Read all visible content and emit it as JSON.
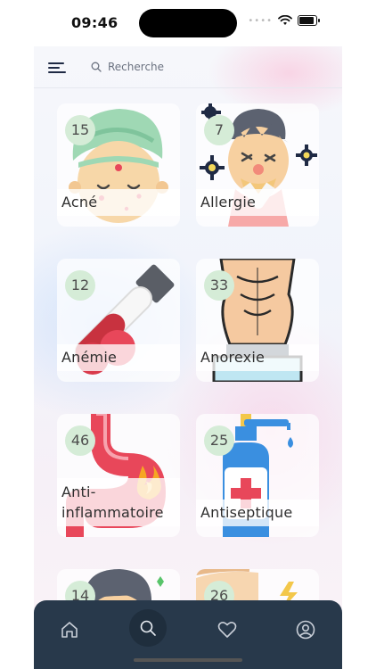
{
  "status_bar": {
    "time": "09:46"
  },
  "search": {
    "placeholder": "Recherche"
  },
  "categories": [
    {
      "label": "Acné",
      "count": "15",
      "icon": "turban-face-icon"
    },
    {
      "label": "Allergie",
      "count": "7",
      "icon": "sneezing-face-icon"
    },
    {
      "label": "Anémie",
      "count": "12",
      "icon": "blood-tube-icon"
    },
    {
      "label": "Anorexie",
      "count": "33",
      "icon": "thin-torso-icon"
    },
    {
      "label_line1": "Anti-",
      "label_line2": "inflammatoire",
      "count": "46",
      "icon": "stomach-fire-icon"
    },
    {
      "label": "Antiseptique",
      "count": "25",
      "icon": "sanitizer-bottle-icon"
    },
    {
      "count": "14",
      "icon": "head-icon"
    },
    {
      "count": "26",
      "icon": "lightning-icon"
    }
  ],
  "nav": [
    "home",
    "search",
    "favorites",
    "profile"
  ],
  "colors": {
    "count_badge": "#d5ecd7",
    "nav_background": "#28394b",
    "accent_red": "#e8475a"
  }
}
